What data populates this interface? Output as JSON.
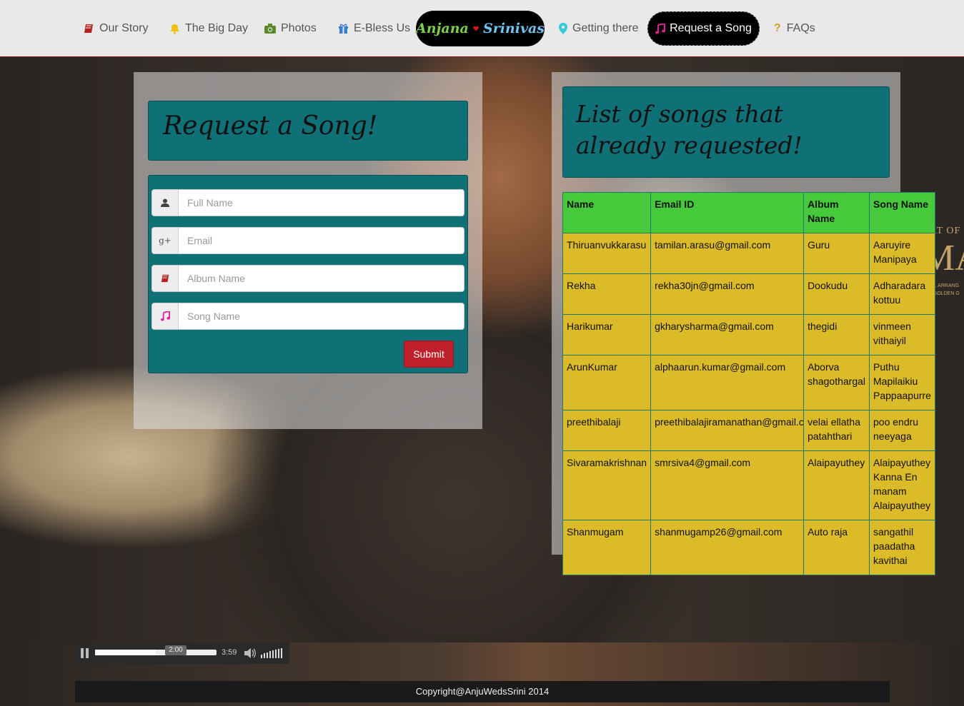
{
  "nav": {
    "items": [
      {
        "label": "Our Story",
        "icon": "book-icon"
      },
      {
        "label": "The Big Day",
        "icon": "bell-icon"
      },
      {
        "label": "Photos",
        "icon": "camera-icon"
      },
      {
        "label": "E-Bless Us",
        "icon": "gift-icon"
      },
      {
        "label": "Getting there",
        "icon": "map-marker-icon"
      },
      {
        "label": "Request a Song",
        "icon": "music-icon",
        "active": true
      },
      {
        "label": "FAQs",
        "icon": "question-icon"
      }
    ],
    "brand": {
      "name1": "Anjana",
      "name2": "Srinivas"
    }
  },
  "request_form": {
    "title": "Request a Song!",
    "fields": [
      {
        "placeholder": "Full Name",
        "icon": "user-icon",
        "value": ""
      },
      {
        "placeholder": "Email",
        "icon": "google-plus-icon",
        "value": ""
      },
      {
        "placeholder": "Album Name",
        "icon": "book-icon",
        "value": ""
      },
      {
        "placeholder": "Song Name",
        "icon": "music-icon",
        "value": ""
      }
    ],
    "submit_label": "Submit"
  },
  "song_list": {
    "title": "List of songs that already requested!",
    "columns": [
      "Name",
      "Email ID",
      "Album Name",
      "Song Name"
    ],
    "rows": [
      [
        "Thiruanvukkarasu",
        "tamilan.arasu@gmail.com",
        "Guru",
        "Aaruyire Manipaya"
      ],
      [
        "Rekha",
        "rekha30jn@gmail.com",
        "Dookudu",
        "Adharadara kottuu"
      ],
      [
        "Harikumar",
        "gkharysharma@gmail.com",
        "thegidi",
        "vinmeen vithaiyil"
      ],
      [
        "ArunKumar",
        "alphaarun.kumar@gmail.com",
        "Aborva shagothargal",
        "Puthu Mapilaikiu Pappaapurre"
      ],
      [
        "preethibalaji",
        "preethibalajiramanathan@gmail.co",
        "velai ellatha patahthari",
        "poo endru neeyaga"
      ],
      [
        "Sivaramakrishnan",
        "smrsiva4@gmail.com",
        "Alaipayuthey",
        "Alaipayuthey Kanna En manam Alaipayuthey"
      ],
      [
        "Shanmugam",
        "shanmugamp26@gmail.com",
        "Auto raja",
        "sangathil paadatha kavithai"
      ]
    ]
  },
  "background_ad": {
    "line1": "ART OF A",
    "big": "MA",
    "small": "ALIST, ARRANG\nRD | GOLDEN G"
  },
  "player": {
    "tooltip": "2:00",
    "duration": "3:59",
    "progress": 0.5
  },
  "footer": {
    "text": "Copyright@AnjuWedsSrini 2014"
  },
  "colors": {
    "teal": "#0f7075",
    "header_green": "#46c93b",
    "cell_yellow": "#dcbb28",
    "submit_red": "#c0202a"
  }
}
